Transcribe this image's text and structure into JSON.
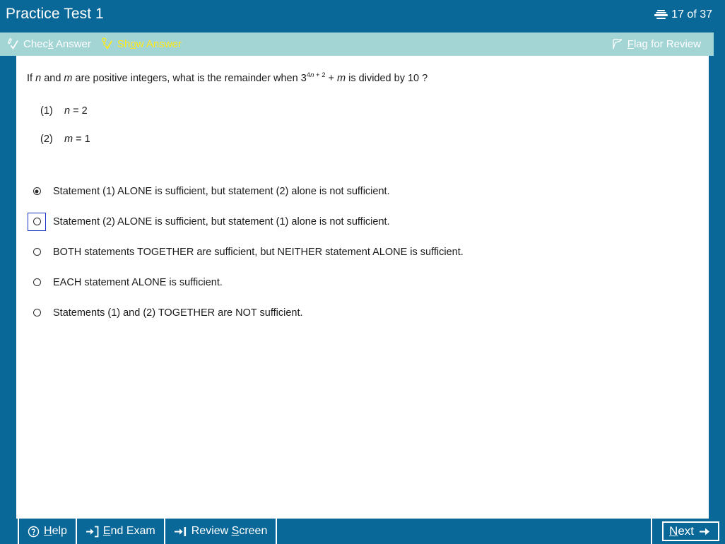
{
  "header": {
    "title": "Practice Test 1",
    "page_indicator": "17 of 37",
    "pages_icon": "stacked-pages-icon"
  },
  "toolbar": {
    "check_answer": {
      "label": "Check Answer",
      "accel": "k",
      "icon": "check-pencil-icon",
      "color": "#ffffff"
    },
    "show_answer": {
      "label": "Show Answer",
      "accel": "o",
      "icon": "key-check-icon",
      "color": "#ffe819"
    },
    "flag_review": {
      "label": "Flag for Review",
      "accel": "F",
      "icon": "flag-outline-icon",
      "color": "#ffffff"
    },
    "background": "#a3d5d5"
  },
  "question": {
    "prefix": "If ",
    "var_n": "n",
    "mid1": " and ",
    "var_m": "m",
    "mid2": " are positive integers, what is the remainder when 3",
    "exponent_coef": "4",
    "exponent_var": "n",
    "exponent_rest": " + 2",
    "mid3": " + ",
    "var_m2": "m",
    "suffix": " is divided by 10 ?",
    "statements": [
      {
        "num": "(1)",
        "var": "n",
        "eq": " = 2"
      },
      {
        "num": "(2)",
        "var": "m",
        "eq": " = 1"
      }
    ]
  },
  "options": [
    {
      "id": "A",
      "label": "Statement (1) ALONE is sufficient, but statement (2) alone is not sufficient.",
      "checked": true,
      "focused": false
    },
    {
      "id": "B",
      "label": "Statement (2) ALONE is sufficient, but statement (1) alone is not sufficient.",
      "checked": false,
      "focused": true
    },
    {
      "id": "C",
      "label": "BOTH statements TOGETHER are sufficient, but NEITHER statement ALONE is sufficient.",
      "checked": false,
      "focused": false
    },
    {
      "id": "D",
      "label": "EACH statement ALONE is sufficient.",
      "checked": false,
      "focused": false
    },
    {
      "id": "E",
      "label": "Statements (1) and (2) TOGETHER are NOT sufficient.",
      "checked": false,
      "focused": false
    }
  ],
  "bottom_bar": {
    "help": {
      "label": "Help",
      "accel": "H",
      "icon": "question-circle-icon"
    },
    "end_exam": {
      "label": "End Exam",
      "accel": "E",
      "icon": "exit-arrow-icon"
    },
    "review": {
      "label": "Review Screen",
      "accel": "S",
      "icon": "arrow-to-bar-icon"
    },
    "next": {
      "label": "Next",
      "accel": "N",
      "icon": "arrow-right-icon",
      "focused": true
    }
  },
  "colors": {
    "header_blue": "#0a6898",
    "toolbar_teal": "#a3d5d5",
    "accent_yellow": "#ffe819",
    "focus_blue": "#1a33c8",
    "content_white": "#ffffff"
  }
}
